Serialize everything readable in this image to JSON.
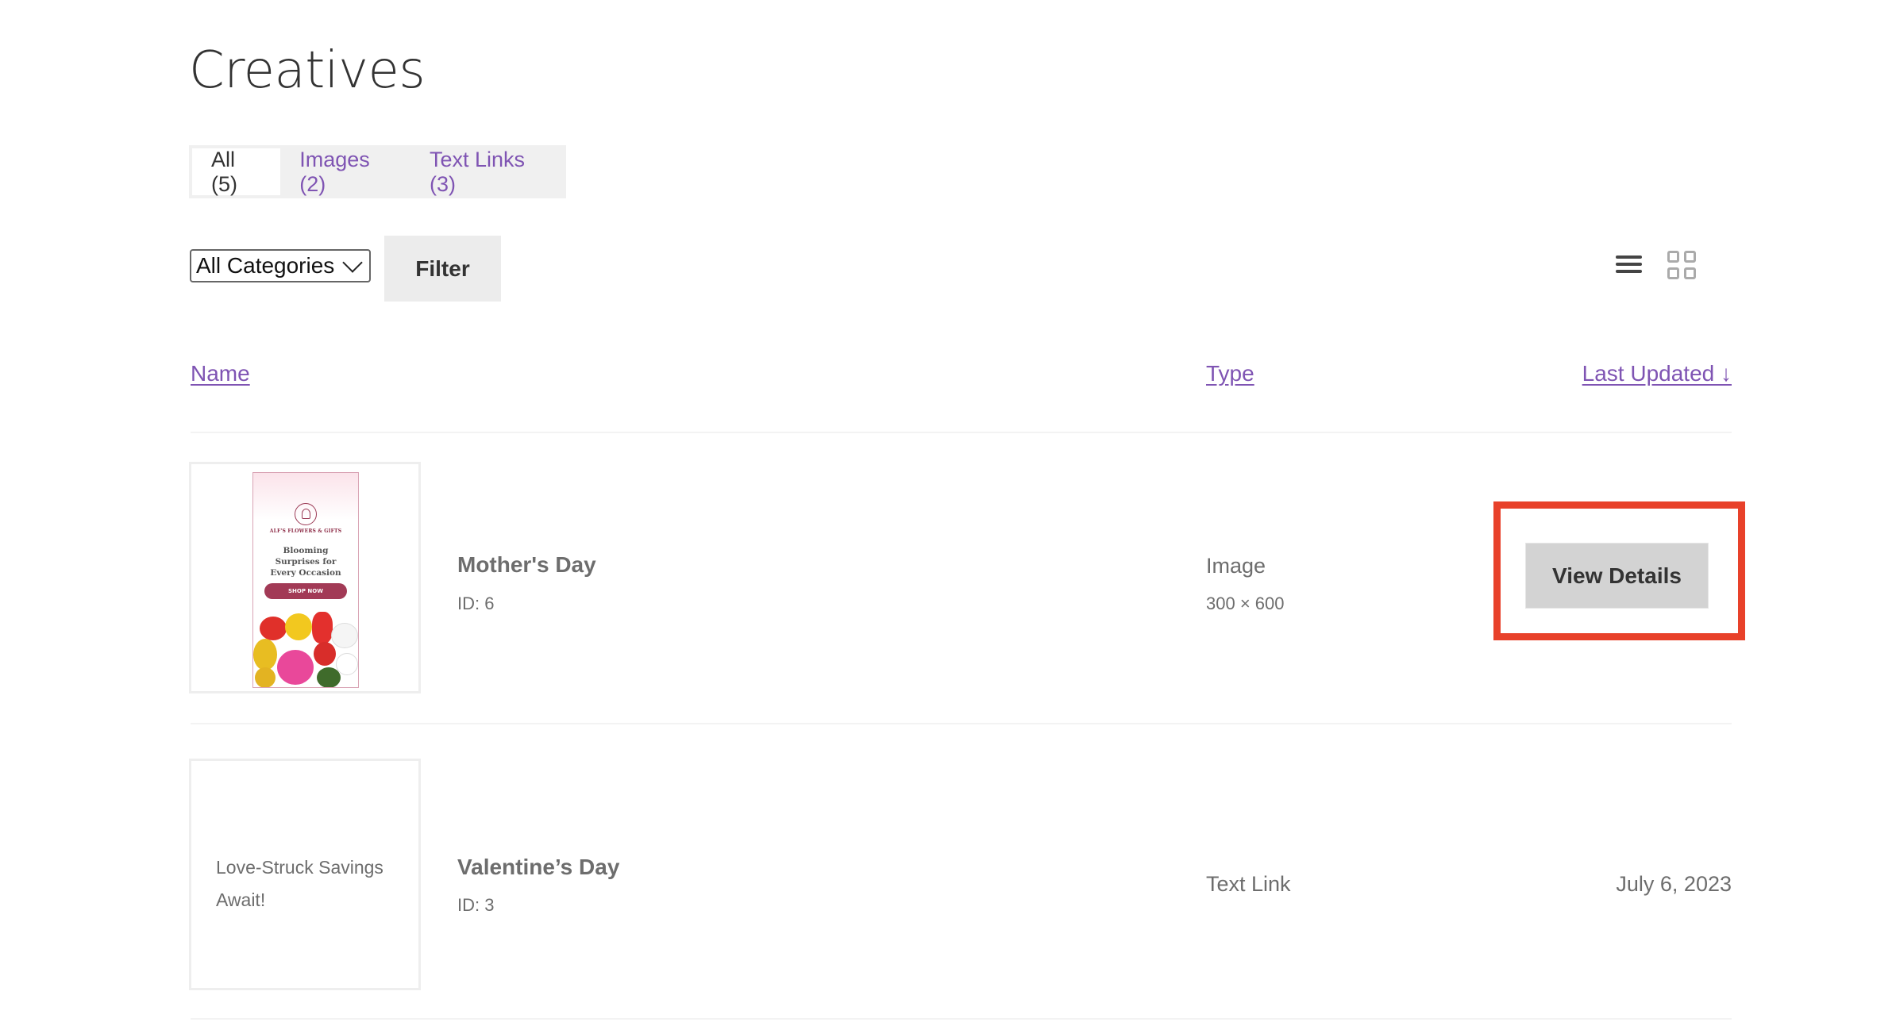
{
  "page": {
    "title": "Creatives"
  },
  "tabs": [
    {
      "label": "All (5)",
      "active": true
    },
    {
      "label": "Images (2)",
      "active": false
    },
    {
      "label": "Text Links (3)",
      "active": false
    }
  ],
  "filters": {
    "category_select": {
      "value": "All Categories"
    },
    "filter_label": "Filter"
  },
  "view_toggle": {
    "list_icon": "list-view-icon",
    "grid_icon": "grid-view-icon",
    "active": "list"
  },
  "columns": {
    "name": "Name",
    "type": "Type",
    "last_updated": "Last Updated ↓"
  },
  "colors": {
    "link": "#7f54b3",
    "highlight": "#e8412a"
  },
  "rows": [
    {
      "name": "Mother's Day",
      "id": "ID: 6",
      "type": "Image",
      "dimensions": "300 × 600",
      "action_label": "View Details",
      "preview": {
        "brand": "ALF'S FLOWERS & GIFTS",
        "headline_lines": [
          "Blooming",
          "Surprises for",
          "Every Occasion"
        ],
        "cta": "SHOP NOW"
      }
    },
    {
      "name": "Valentine’s Day",
      "id": "ID: 3",
      "type": "Text Link",
      "last_updated": "July 6, 2023",
      "preview_text": "Love-Struck Savings Await!"
    }
  ]
}
